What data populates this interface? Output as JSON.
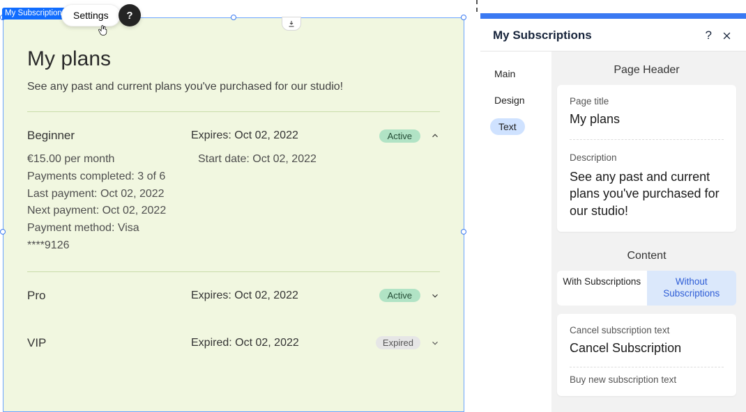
{
  "overlay": {
    "selection_label": "My Subscriptions",
    "settings_label": "Settings",
    "help_label": "?"
  },
  "page": {
    "title": "My plans",
    "description": "See any past and current plans you've purchased for our studio!"
  },
  "plans": {
    "p1": {
      "name": "Beginner",
      "expires": "Expires: Oct 02, 2022",
      "status": "Active",
      "price": "€15.00 per month",
      "start": "Start date: Oct 02, 2022",
      "payments_completed": "Payments completed: 3 of 6",
      "last_payment": "Last payment: Oct 02, 2022",
      "next_payment": "Next payment: Oct 02, 2022",
      "payment_method": "Payment method: Visa",
      "card_mask": "****9126"
    },
    "p2": {
      "name": "Pro",
      "expires": "Expires: Oct 02, 2022",
      "status": "Active"
    },
    "p3": {
      "name": "VIP",
      "expires": "Expired: Oct 02, 2022",
      "status": "Expired"
    }
  },
  "panel": {
    "title": "My Subscriptions",
    "tabs": {
      "main": "Main",
      "design": "Design",
      "text": "Text"
    },
    "section_page_header": "Page Header",
    "page_title_label": "Page title",
    "page_title_value": "My plans",
    "description_label": "Description",
    "description_value": "See any past and current plans you've purchased for our studio!",
    "section_content": "Content",
    "content_tab_with": "With Subscriptions",
    "content_tab_without": "Without Subscriptions",
    "cancel_label": "Cancel subscription text",
    "cancel_value": "Cancel Subscription",
    "buy_label": "Buy new subscription text"
  }
}
